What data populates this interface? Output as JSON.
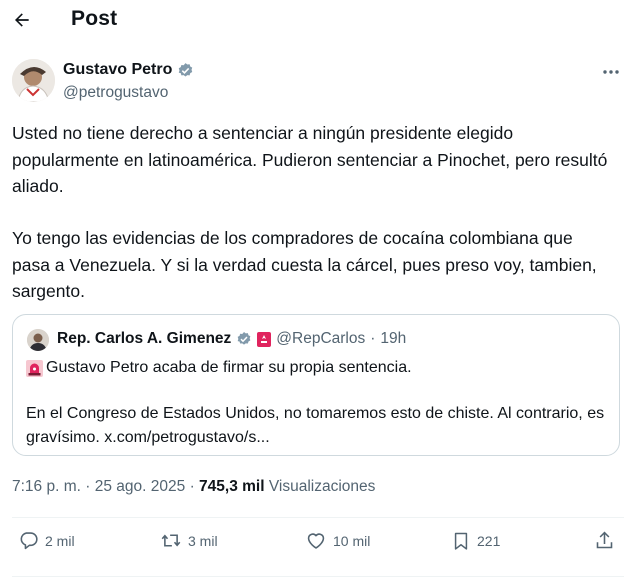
{
  "header": {
    "title": "Post"
  },
  "author": {
    "name": "Gustavo Petro",
    "handle": "@petrogustavo",
    "verified_color": "#829aab"
  },
  "tweet": {
    "paragraph1": "Usted no tiene derecho a sentenciar a ningún presidente elegido popularmente en latinoamérica. Pudieron sentenciar a Pinochet, pero resultó aliado.",
    "paragraph2": "Yo tengo las evidencias de los compradores de cocaína colombiana que pasa a Venezuela. Y si la verdad cuesta la cárcel, pues preso voy, tambien, sargento."
  },
  "quote": {
    "name": "Rep. Carlos A. Gimenez",
    "handle": "@RepCarlos",
    "separator": "·",
    "time": "19h",
    "line1": "Gustavo Petro acaba de firmar su propia sentencia.",
    "line2": "En el Congreso de Estados Unidos, no tomaremos esto de chiste. Al contrario, es gravísimo. x.com/petrogustavo/s..."
  },
  "meta": {
    "time": "7:16 p. m.",
    "sep": "·",
    "date": "25 ago. 2025",
    "views_count": "745,3 mil",
    "views_label": "Visualizaciones"
  },
  "actions": {
    "replies": "2 mil",
    "reposts": "3 mil",
    "likes": "10 mil",
    "bookmarks": "221"
  },
  "icons": [
    "back-arrow-icon",
    "verified-badge-icon",
    "more-icon",
    "flag-icon",
    "siren-icon",
    "reply-icon",
    "repost-icon",
    "like-icon",
    "bookmark-icon",
    "share-icon"
  ],
  "colors": {
    "text": "#0f1419",
    "secondary": "#536471",
    "border": "#cfd9de",
    "siren": "#e0245e"
  }
}
